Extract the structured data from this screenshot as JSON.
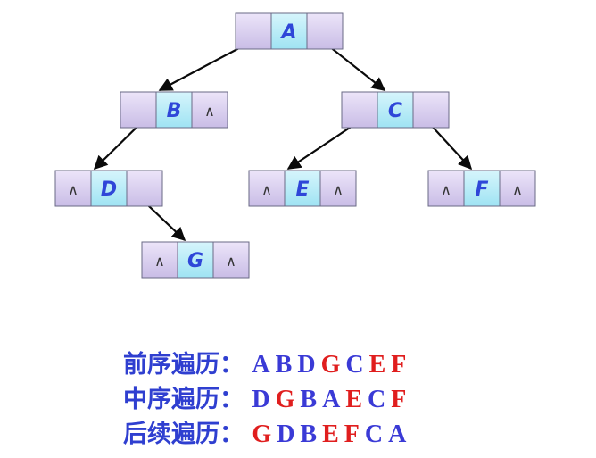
{
  "colors": {
    "label": "#2f3fd0",
    "blue_letter": "#3a3ad6",
    "red_letter": "#e01e1e",
    "node_letter": "#2f46d8",
    "pointer_cell": "#d9cfee",
    "data_cell": "#b8ecf8"
  },
  "null_symbol": "∧",
  "tree": {
    "nodes": [
      {
        "id": "A",
        "left": null,
        "right": null
      },
      {
        "id": "B",
        "left": null,
        "right": "∧"
      },
      {
        "id": "C",
        "left": null,
        "right": null
      },
      {
        "id": "D",
        "left": "∧",
        "right": null
      },
      {
        "id": "E",
        "left": "∧",
        "right": "∧"
      },
      {
        "id": "F",
        "left": "∧",
        "right": "∧"
      },
      {
        "id": "G",
        "left": "∧",
        "right": "∧"
      }
    ],
    "edges": [
      {
        "from": "A",
        "to": "B",
        "side": "left"
      },
      {
        "from": "A",
        "to": "C",
        "side": "right"
      },
      {
        "from": "B",
        "to": "D",
        "side": "left"
      },
      {
        "from": "C",
        "to": "E",
        "side": "left"
      },
      {
        "from": "C",
        "to": "F",
        "side": "right"
      },
      {
        "from": "D",
        "to": "G",
        "side": "right"
      }
    ]
  },
  "traversals": [
    {
      "label": "前序遍历：",
      "sequence": [
        {
          "letter": "A",
          "color": "blue"
        },
        {
          "letter": "B",
          "color": "blue"
        },
        {
          "letter": "D",
          "color": "blue"
        },
        {
          "letter": "G",
          "color": "red"
        },
        {
          "letter": "C",
          "color": "blue"
        },
        {
          "letter": "E",
          "color": "red"
        },
        {
          "letter": "F",
          "color": "red"
        }
      ]
    },
    {
      "label": "中序遍历：",
      "sequence": [
        {
          "letter": "D",
          "color": "blue"
        },
        {
          "letter": "G",
          "color": "red"
        },
        {
          "letter": "B",
          "color": "blue"
        },
        {
          "letter": "A",
          "color": "blue"
        },
        {
          "letter": "E",
          "color": "red"
        },
        {
          "letter": "C",
          "color": "blue"
        },
        {
          "letter": "F",
          "color": "red"
        }
      ]
    },
    {
      "label": "后续遍历：",
      "sequence": [
        {
          "letter": "G",
          "color": "red"
        },
        {
          "letter": "D",
          "color": "blue"
        },
        {
          "letter": "B",
          "color": "blue"
        },
        {
          "letter": "E",
          "color": "red"
        },
        {
          "letter": "F",
          "color": "red"
        },
        {
          "letter": "C",
          "color": "blue"
        },
        {
          "letter": "A",
          "color": "blue"
        }
      ]
    }
  ]
}
